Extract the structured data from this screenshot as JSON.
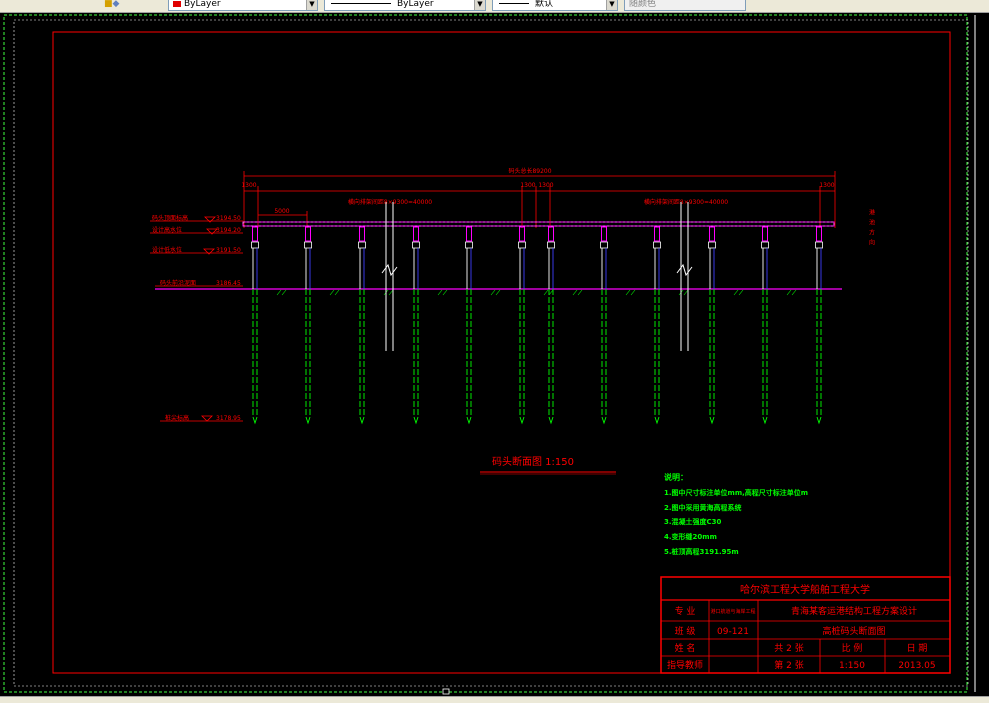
{
  "toolbar": {
    "color_value": "ByLayer",
    "linetype_value": "ByLayer",
    "lineweight_value": "默认",
    "plotstyle_value": "随颜色"
  },
  "drawing": {
    "total_length": "码头总长89200",
    "dim_left_end": "1300",
    "dim_left_span": "横向排架间距8×9300=40000",
    "dim_mid_left": "1300",
    "dim_mid_right": "1300",
    "dim_right_span": "横向排架间距8×9300=40000",
    "dim_right_end": "1300",
    "pile_spacing": "5000",
    "lbl_deck": "码头顶面标高",
    "val_deck": "3194.50",
    "lbl_design_water": "设计高水位",
    "val_design_water": "3194.20",
    "lbl_low_water": "设计低水位",
    "val_low_water": "3191.50",
    "lbl_mudline": "码头前沿泥面",
    "val_mudline": "3186.45",
    "lbl_pile_tip": "桩尖标高",
    "val_pile_tip": "3178.95",
    "right_label": "港池方向",
    "section_title": "码头断面图 1:150"
  },
  "notes": {
    "heading": "说明：",
    "items": [
      "1.图中尺寸标注单位mm,高程尺寸标注单位m",
      "2.图中采用黄海高程系统",
      "3.混凝土强度C30",
      "4.变形缝20mm",
      "5.桩顶高程3191.95m"
    ]
  },
  "title_block": {
    "school": "哈尔滨工程大学船舶工程大学",
    "major_label": "专 业",
    "major_value": "港口航道与海岸工程",
    "project_title": "青海某客运港结构工程方案设计",
    "class_label": "班 级",
    "class_value": "09-121",
    "drawing_name": "高桩码头断面图",
    "name_label": "姓 名",
    "sheets_total": "共 2 张",
    "scale_label": "比 例",
    "date_label": "日 期",
    "advisor_label": "指导教师",
    "sheet_no": "第 2 张",
    "scale_value": "1:150",
    "date_value": "2013.05"
  },
  "colors": {
    "background": "#000000",
    "frame_red": "#ff0000",
    "pile_green": "#00ff00",
    "pile_blue": "#4040ff",
    "mudline_magenta": "#ff00ff",
    "note_green": "#00ff00",
    "viewport_dash": "#40ff40"
  }
}
